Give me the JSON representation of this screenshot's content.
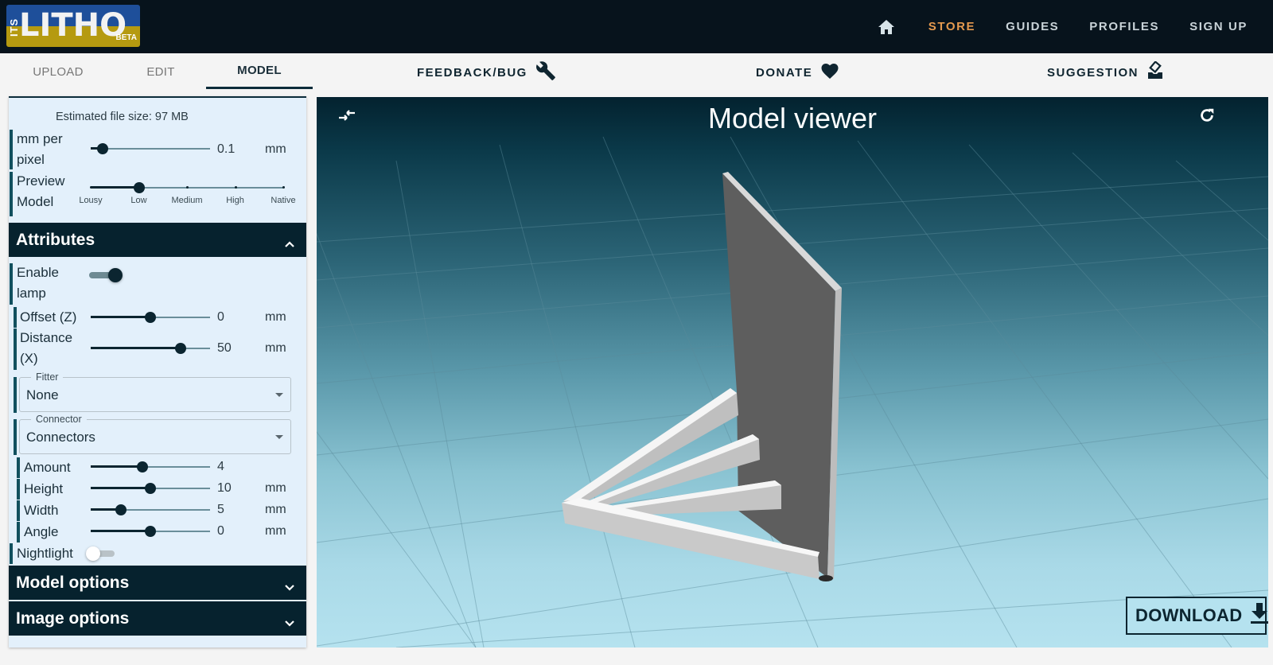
{
  "app": {
    "logo_prefix": "ITS",
    "logo_main": "LITHO",
    "logo_badge": "BETA"
  },
  "nav": {
    "home_icon": "home-icon",
    "links": [
      "STORE",
      "GUIDES",
      "PROFILES",
      "SIGN UP"
    ],
    "accent_color": "#e59a4f"
  },
  "tabs": [
    {
      "label": "UPLOAD",
      "active": false
    },
    {
      "label": "EDIT",
      "active": false
    },
    {
      "label": "MODEL",
      "active": true
    }
  ],
  "actions": {
    "feedback": {
      "label": "FEEDBACK/BUG",
      "icon": "wrench-icon"
    },
    "donate": {
      "label": "DONATE",
      "icon": "heart-icon"
    },
    "suggestion": {
      "label": "SUGGESTION",
      "icon": "ballot-box-icon"
    }
  },
  "panel": {
    "file_size": "Estimated file size: 97 MB",
    "mm_per_pixel": {
      "label": "mm per pixel",
      "value": "0.1",
      "unit": "mm",
      "fraction": 0.1
    },
    "preview_model": {
      "label": "Preview Model",
      "options": [
        "Lousy",
        "Low",
        "Medium",
        "High",
        "Native"
      ],
      "selected": "Low",
      "selected_index": 1
    },
    "attributes": {
      "title": "Attributes",
      "expanded": true,
      "enable_lamp": {
        "label": "Enable lamp",
        "on": true
      },
      "offset_z": {
        "label": "Offset (Z)",
        "value": "0",
        "unit": "mm",
        "fraction": 0.5
      },
      "distance_x": {
        "label": "Distance (X)",
        "value": "50",
        "unit": "mm",
        "fraction": 0.75
      },
      "fitter": {
        "legend": "Fitter",
        "value": "None"
      },
      "connector": {
        "legend": "Connector",
        "value": "Connectors"
      },
      "amount": {
        "label": "Amount",
        "value": "4",
        "unit": "",
        "fraction": 0.43
      },
      "height": {
        "label": "Height",
        "value": "10",
        "unit": "mm",
        "fraction": 0.5
      },
      "width": {
        "label": "Width",
        "value": "5",
        "unit": "mm",
        "fraction": 0.25
      },
      "angle": {
        "label": "Angle",
        "value": "0",
        "unit": "mm",
        "fraction": 0.5
      },
      "nightlight": {
        "label": "Nightlight",
        "on": false
      }
    },
    "model_options": {
      "title": "Model options",
      "expanded": false
    },
    "image_options": {
      "title": "Image options",
      "expanded": false
    }
  },
  "viewer": {
    "title": "Model viewer",
    "collapse_icon": "collapse-arrows-icon",
    "reset_icon": "refresh-icon",
    "download_label": "DOWNLOAD",
    "download_icon": "download-icon"
  }
}
